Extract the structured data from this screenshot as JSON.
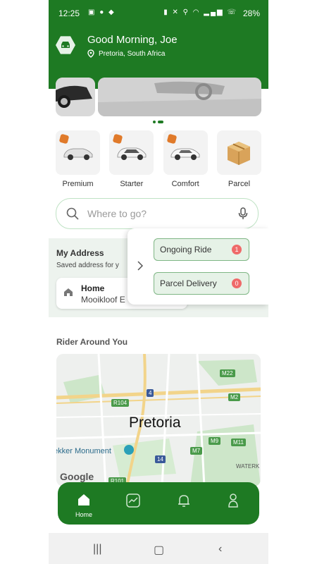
{
  "status_bar": {
    "time": "12:25",
    "battery": "28%"
  },
  "header": {
    "greeting": "Good Morning, Joe",
    "location": "Pretoria, South Africa"
  },
  "categories": [
    {
      "label": "Premium",
      "icon": "car-icon"
    },
    {
      "label": "Starter",
      "icon": "car-icon"
    },
    {
      "label": "Comfort",
      "icon": "car-icon"
    },
    {
      "label": "Parcel",
      "icon": "box-icon"
    }
  ],
  "search": {
    "placeholder": "Where to go?"
  },
  "my_address": {
    "title": "My Address",
    "subtitle": "Saved address for y",
    "home": {
      "title": "Home",
      "value": "Mooikloof E"
    }
  },
  "popup": {
    "items": [
      {
        "label": "Ongoing Ride",
        "count": "1"
      },
      {
        "label": "Parcel Delivery",
        "count": "0"
      }
    ]
  },
  "riders": {
    "title": "Rider Around You",
    "map": {
      "city": "Pretoria",
      "landmark": "ekker Monument",
      "area": "WATERK",
      "attribution": "Google",
      "road_labels": [
        "M22",
        "M2",
        "R104",
        "4",
        "M9",
        "M11",
        "M7",
        "14",
        "R101"
      ]
    }
  },
  "bottom_nav": {
    "items": [
      {
        "label": "Home",
        "icon": "home-icon"
      },
      {
        "label": "",
        "icon": "activity-icon"
      },
      {
        "label": "",
        "icon": "bell-icon"
      },
      {
        "label": "",
        "icon": "profile-icon"
      }
    ]
  },
  "colors": {
    "primary": "#1e7a23",
    "light_green": "#e6f2e7",
    "badge_red": "#ef6a6a",
    "badge_orange": "#e07a2a"
  }
}
